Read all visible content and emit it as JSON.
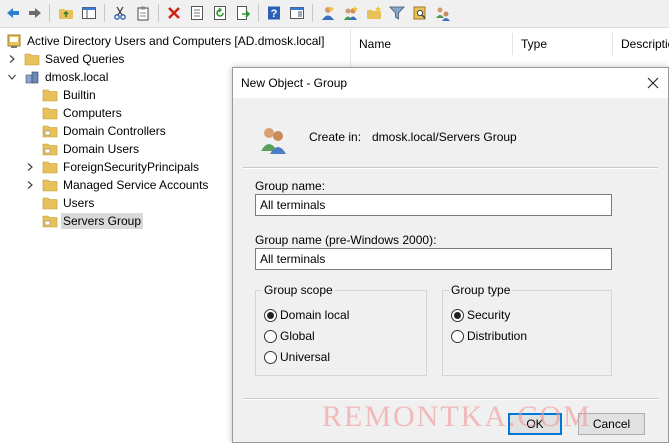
{
  "toolbar": {
    "buttons": [
      "back-icon",
      "forward-icon",
      "folder-up-icon",
      "console-tree-icon",
      "cut-icon",
      "clipboard-icon",
      "delete-icon",
      "properties-icon",
      "refresh-icon",
      "export-icon",
      "help-icon",
      "show-hide-icon",
      "new-user-icon",
      "new-group-icon",
      "new-ou-icon",
      "filter-icon",
      "find-icon",
      "add-to-group-icon"
    ]
  },
  "tree": {
    "root": "Active Directory Users and Computers [AD.dmosk.local]",
    "saved_queries": "Saved Queries",
    "domain": "dmosk.local",
    "items": [
      "Builtin",
      "Computers",
      "Domain Controllers",
      "Domain Users",
      "ForeignSecurityPrincipals",
      "Managed Service Accounts",
      "Users",
      "Servers Group"
    ]
  },
  "list": {
    "columns": [
      "Name",
      "Type",
      "Descriptio"
    ]
  },
  "dialog": {
    "title": "New Object - Group",
    "create_in_label": "Create in:",
    "create_in_path": "dmosk.local/Servers Group",
    "group_name_label": "Group name:",
    "group_name_value": "All terminals",
    "pre2000_label": "Group name (pre-Windows 2000):",
    "pre2000_value": "All terminals",
    "scope": {
      "legend": "Group scope",
      "options": [
        "Domain local",
        "Global",
        "Universal"
      ],
      "selected": "Domain local"
    },
    "type": {
      "legend": "Group type",
      "options": [
        "Security",
        "Distribution"
      ],
      "selected": "Security"
    },
    "ok_label": "OK",
    "cancel_label": "Cancel"
  },
  "watermark": "REMONTKA.COM",
  "colors": {
    "folder": "#e8c15a",
    "selection": "#d9d9d9",
    "default_button": "#0078d7"
  }
}
